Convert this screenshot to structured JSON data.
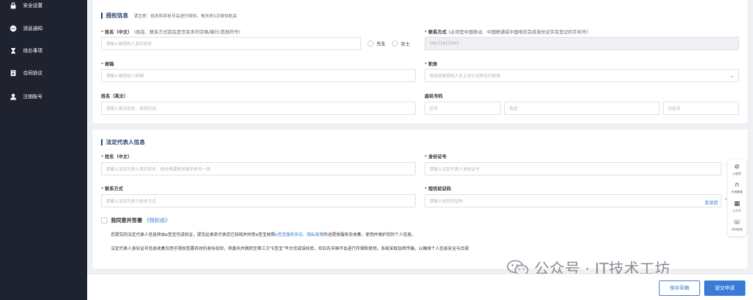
{
  "sidebar": {
    "items": [
      {
        "label": "安全设置",
        "icon": "lock-icon"
      },
      {
        "label": "消息通知",
        "icon": "message-icon"
      },
      {
        "label": "待办事项",
        "icon": "hourglass-icon"
      },
      {
        "label": "合同协议",
        "icon": "contract-icon"
      },
      {
        "label": "注销账号",
        "icon": "user-icon"
      }
    ]
  },
  "auth": {
    "title": "授权信息",
    "note": "请注意：姓名和手机号会进行核验，每天有5次核验机会",
    "name_label": "姓名（中文）",
    "name_hint": "(姓名、联系方式前后是否有多的空格/换行/其他符号)",
    "name_placeholder": "请输入被授权人真实姓名",
    "gender_male": "先生",
    "gender_female": "女士",
    "contact_label": "联系方式",
    "contact_hint": "(必须是中国移动、中国联通或中国电信完成身份证实名登记的手机号)",
    "contact_value": "18171615343",
    "email_label": "邮箱",
    "email_placeholder": "请输入被授权人邮箱",
    "position_label": "职务",
    "position_placeholder": "请选择被授权人在上述公司担任的职务",
    "name_en_label": "姓名（英文）",
    "name_en_placeholder": "请输入英文姓名，如有的话",
    "landline_label": "座机号码",
    "area_placeholder": "区号",
    "phone_placeholder": "电话",
    "ext_placeholder": "分机号"
  },
  "legal": {
    "title": "法定代表人信息",
    "name_label": "姓名（中文）",
    "name_placeholder": "请输入法定代表人真实姓名，姓名需要和关联手机号一致",
    "id_label": "身份证号",
    "id_placeholder": "请输入法定代表人身份证号",
    "contact_label": "联系方式",
    "contact_placeholder": "请输入法定代表人联系方式",
    "sms_label": "短信验证码",
    "sms_placeholder": "请输入短信验证码",
    "sms_send": "发送验",
    "agree_text": "我同意并签署",
    "agree_link": "《授权函》",
    "para1_a": "您提交的法定代表人信息将由e签宝完成验证，提交此表单代表您已知晓并同意e签宝按照",
    "para1_link1": "e签宝服务协议",
    "para1_sep": "、",
    "para1_link2": "隐私政策",
    "para1_b": "所述提供服务及收集、使用并保护您的个人信息。",
    "para2": "法定代表人身份证号信息收集仅用于授权签署名时的身份校验，将委托并跳转至第三方\"E签宝\"平台完成该校验，邓白氏中国不会进行存储和使用，系统采取加密传输，以确保个人信息安全与合规"
  },
  "float_bar": {
    "items": [
      {
        "label": "小程序",
        "icon": "miniprogram-icon"
      },
      {
        "label": "在线客服",
        "icon": "headset-icon"
      },
      {
        "label": "公众号",
        "icon": "qrcode-icon"
      },
      {
        "label": "400热线",
        "icon": "phone-icon"
      }
    ]
  },
  "footer": {
    "save_draft": "保存草稿",
    "submit": "提交申请"
  },
  "watermark": {
    "text": "公众号 · IT技术工坊"
  },
  "colors": {
    "sidebar_bg": "#1f2330",
    "accent": "#3a7bd5",
    "required": "#e0393e"
  }
}
